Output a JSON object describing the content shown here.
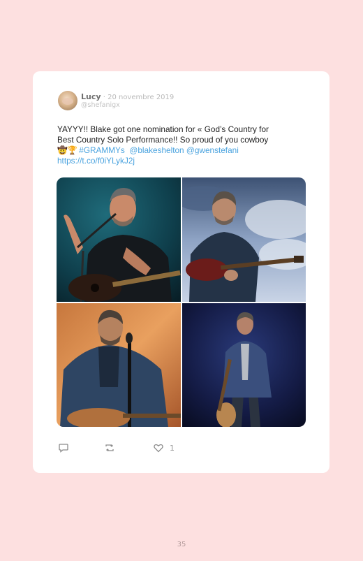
{
  "tweet": {
    "name": "Lucy",
    "date": "· 20 novembre 2019",
    "handle": "@shefanigx",
    "text_line1": "YAYYY!! Blake got one nomination for « God’s Country for",
    "text_line2": "Best Country Solo Performance!! So proud of you cowboy",
    "emoji_cowboy": "🤠",
    "emoji_trophy": "🏆",
    "hashtag": "#GRAMMYs",
    "mention1": "@blakeshelton",
    "mention2": "@gwenstefani",
    "link": "https://t.co/f0iYLykJ2j"
  },
  "photos": [
    {
      "alt": "Blake Shelton singing on stage with guitar"
    },
    {
      "alt": "Blake Shelton playing guitar under cloudy sky"
    },
    {
      "alt": "Blake Shelton in denim jacket at microphone"
    },
    {
      "alt": "Blake Shelton in blue blazer holding guitar"
    }
  ],
  "actions": {
    "reply_icon": "reply-icon",
    "retweet_icon": "retweet-icon",
    "like_icon": "heart-icon",
    "like_count": "1"
  },
  "page": {
    "number": "35"
  },
  "colors": {
    "background": "#fde0e0",
    "card": "#ffffff",
    "link": "#4aa3df"
  }
}
